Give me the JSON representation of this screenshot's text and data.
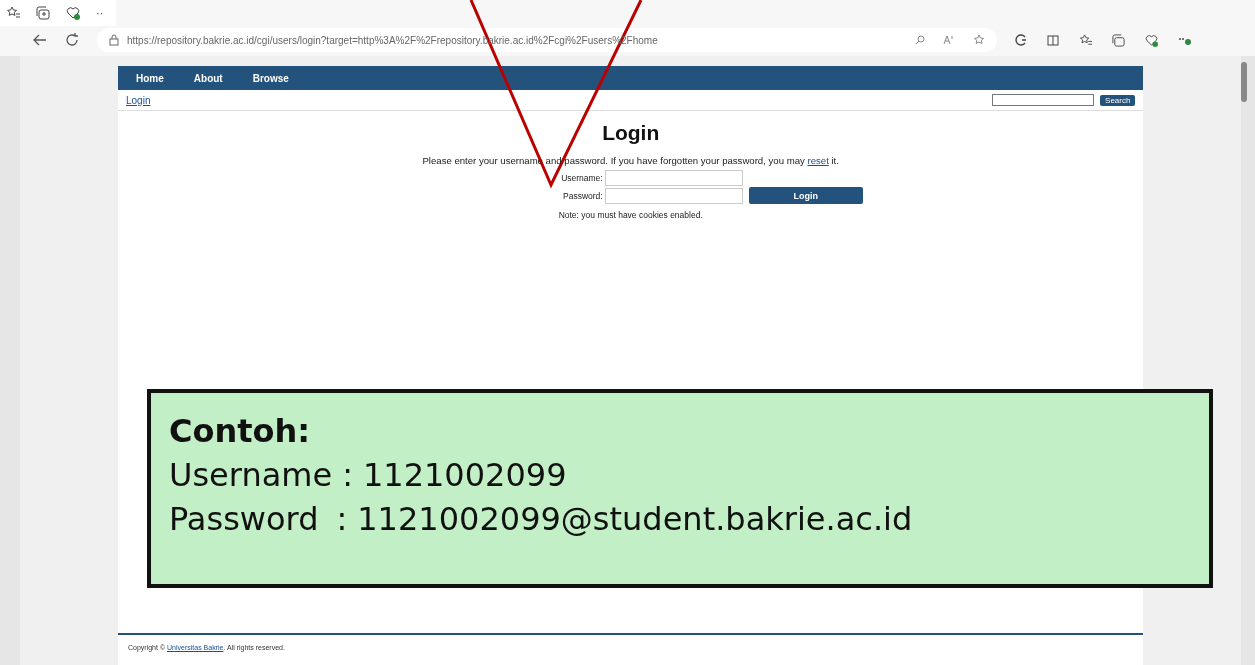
{
  "browser": {
    "more": "··",
    "url": "https://repository.bakrie.ac.id/cgi/users/login?target=http%3A%2F%2Frepository.bakrie.ac.id%2Fcgi%2Fusers%2Fhome"
  },
  "nav": [
    "Home",
    "About",
    "Browse"
  ],
  "login_link": "Login",
  "search": {
    "button": "Search"
  },
  "title": "Login",
  "intro": {
    "text": "Please enter your username and password. If you have forgotten your password, you may",
    "link": "reset",
    "end": "it."
  },
  "form": {
    "username_label": "Username:",
    "password_label": "Password:",
    "button": "Login"
  },
  "note": "Note: you must have cookies enabled.",
  "footer": {
    "prefix": "Copyright ©",
    "link": "Universitas Bakrie",
    "suffix": ". All rights reserved."
  },
  "callout": {
    "heading": "Contoh:",
    "lines": [
      {
        "label": "Username",
        "sep": ":",
        "value": "1121002099"
      },
      {
        "label": "Password",
        "sep": ":",
        "value": "1121002099@student.bakrie.ac.id"
      }
    ]
  }
}
